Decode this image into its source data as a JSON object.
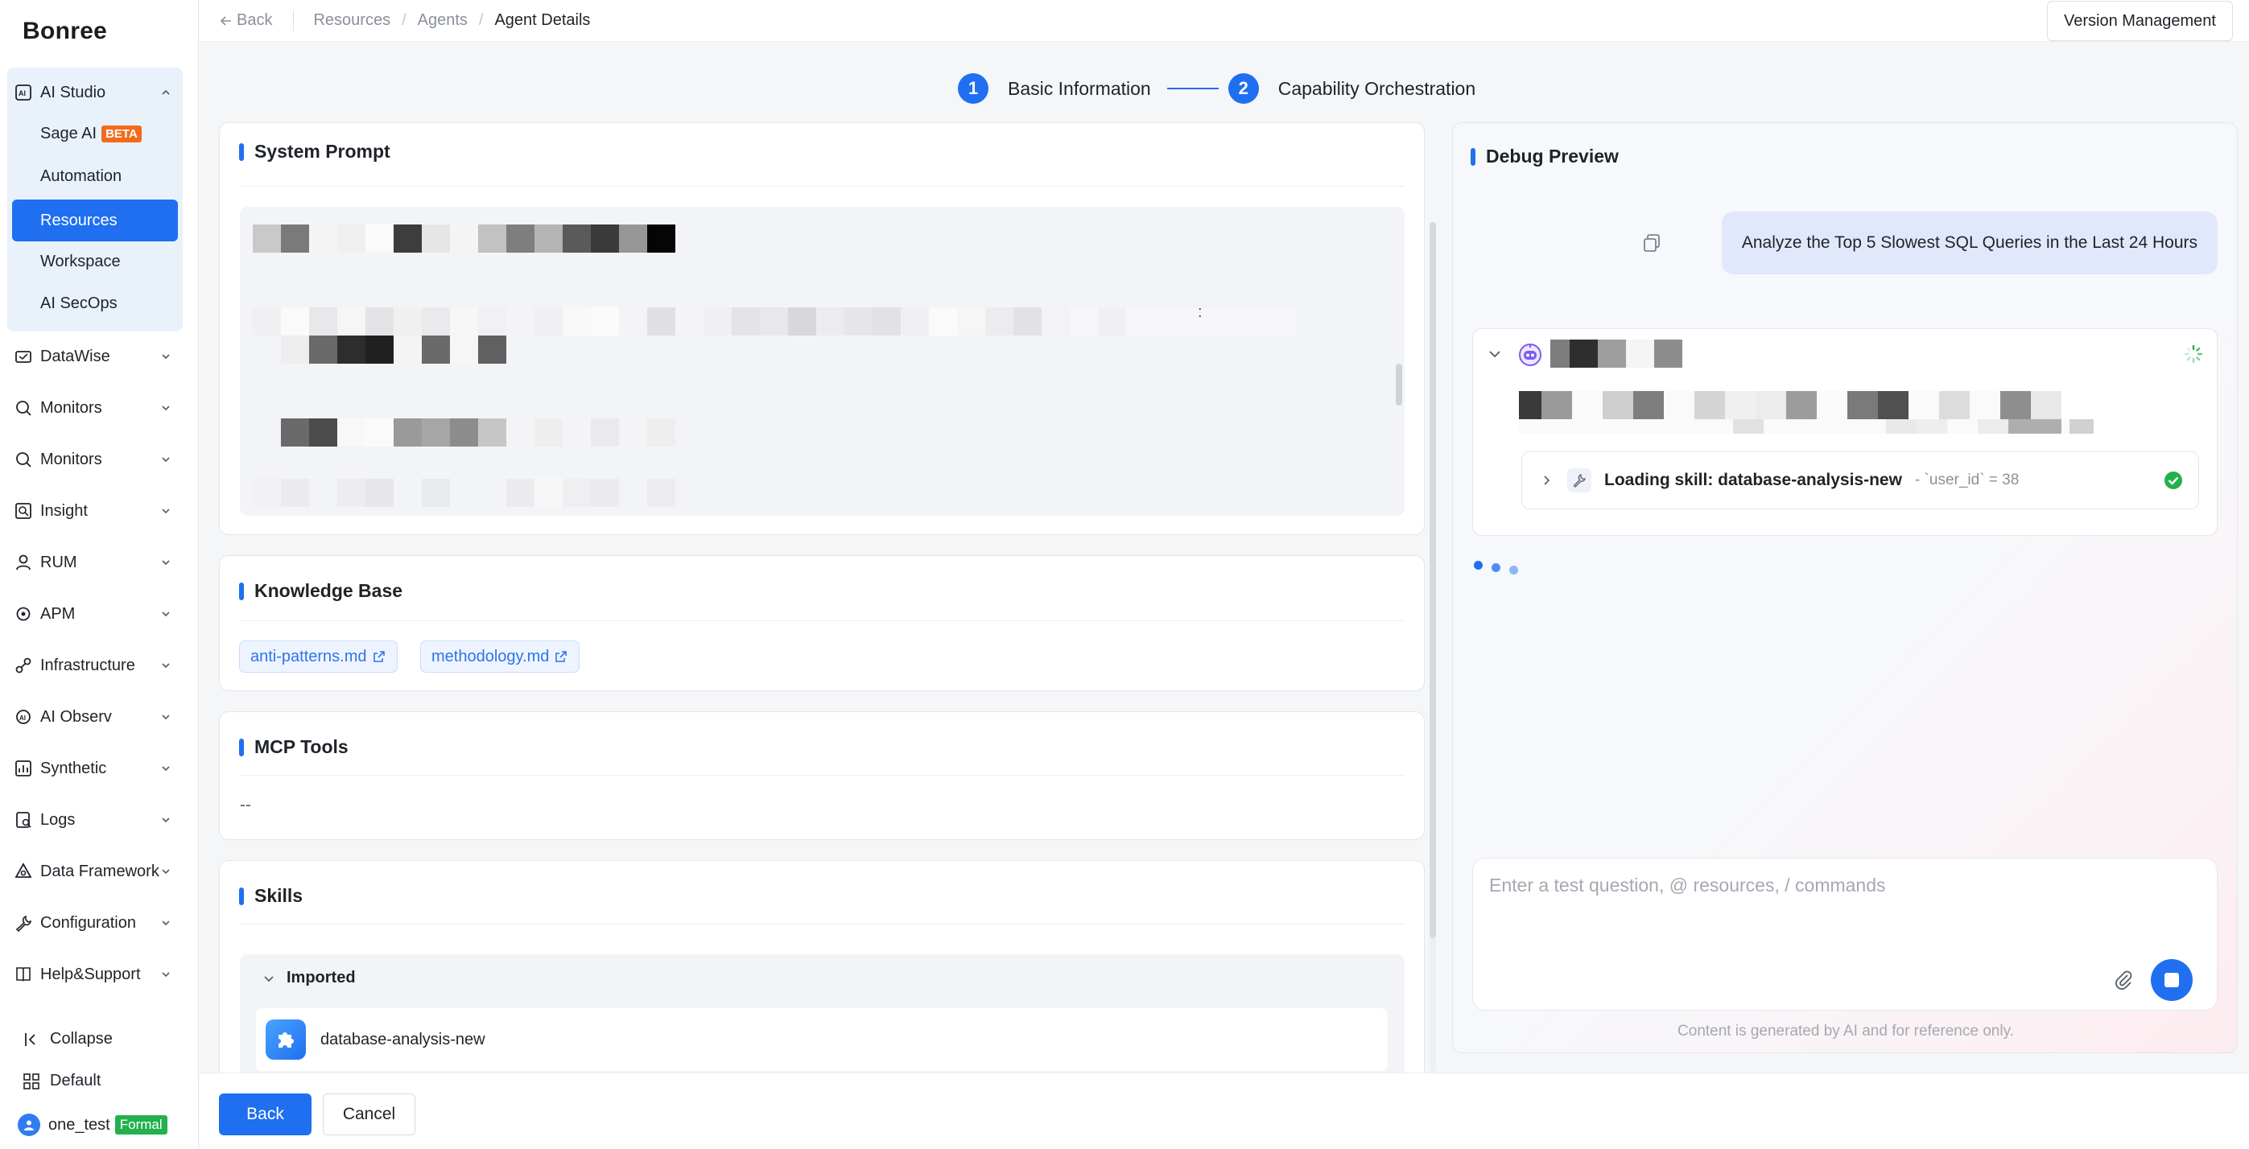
{
  "app": {
    "logo": "Bonree"
  },
  "sidebar": {
    "ai_studio": {
      "label": "AI Studio",
      "icon": "ai-studio-icon"
    },
    "ai_sub": [
      {
        "label": "Sage AI",
        "badge": "BETA"
      },
      {
        "label": "Automation"
      },
      {
        "label": "Resources",
        "active": true
      },
      {
        "label": "Workspace"
      },
      {
        "label": "AI SecOps"
      }
    ],
    "items": [
      {
        "label": "DataWise",
        "icon": "datawise-icon"
      },
      {
        "label": "Monitors",
        "icon": "monitor-icon"
      },
      {
        "label": "Monitors",
        "icon": "monitor-icon"
      },
      {
        "label": "Insight",
        "icon": "insight-icon"
      },
      {
        "label": "RUM",
        "icon": "user-icon"
      },
      {
        "label": "APM",
        "icon": "apm-icon"
      },
      {
        "label": "Infrastructure",
        "icon": "infrastructure-icon"
      },
      {
        "label": "AI Observ",
        "icon": "ai-observ-icon"
      },
      {
        "label": "Synthetic",
        "icon": "chart-icon"
      },
      {
        "label": "Logs",
        "icon": "logs-icon"
      },
      {
        "label": "Data Framework",
        "icon": "data-framework-icon"
      },
      {
        "label": "Configuration",
        "icon": "wrench-icon"
      },
      {
        "label": "Help&Support",
        "icon": "book-icon"
      }
    ],
    "bottom": {
      "collapse": "Collapse",
      "workspace": "Default",
      "user": "one_test",
      "user_badge": "Formal"
    }
  },
  "topbar": {
    "back": "Back",
    "breadcrumb": [
      "Resources",
      "Agents",
      "Agent Details"
    ],
    "version_button": "Version Management"
  },
  "steps": [
    {
      "num": "1",
      "label": "Basic Information"
    },
    {
      "num": "2",
      "label": "Capability Orchestration"
    }
  ],
  "system_prompt": {
    "title": "System Prompt",
    "colon": ":"
  },
  "knowledge_base": {
    "title": "Knowledge Base",
    "files": [
      "anti-patterns.md",
      "methodology.md"
    ]
  },
  "mcp_tools": {
    "title": "MCP Tools",
    "value": "--"
  },
  "skills": {
    "title": "Skills",
    "group": "Imported",
    "items": [
      "database-analysis-new"
    ]
  },
  "debug": {
    "title": "Debug Preview",
    "user_message": "Analyze the Top 5 Slowest SQL Queries in the Last 24 Hours",
    "skill_loading": {
      "label": "Loading skill: database-analysis-new",
      "detail": "- `user_id` = 38"
    },
    "input_placeholder": "Enter a test question, @ resources, / commands",
    "disclaimer": "Content is generated by AI and for reference only."
  },
  "footer": {
    "back": "Back",
    "cancel": "Cancel"
  },
  "colors": {
    "accent": "#1f6ff0",
    "success": "#22b14c",
    "beta": "#f26b1d"
  }
}
